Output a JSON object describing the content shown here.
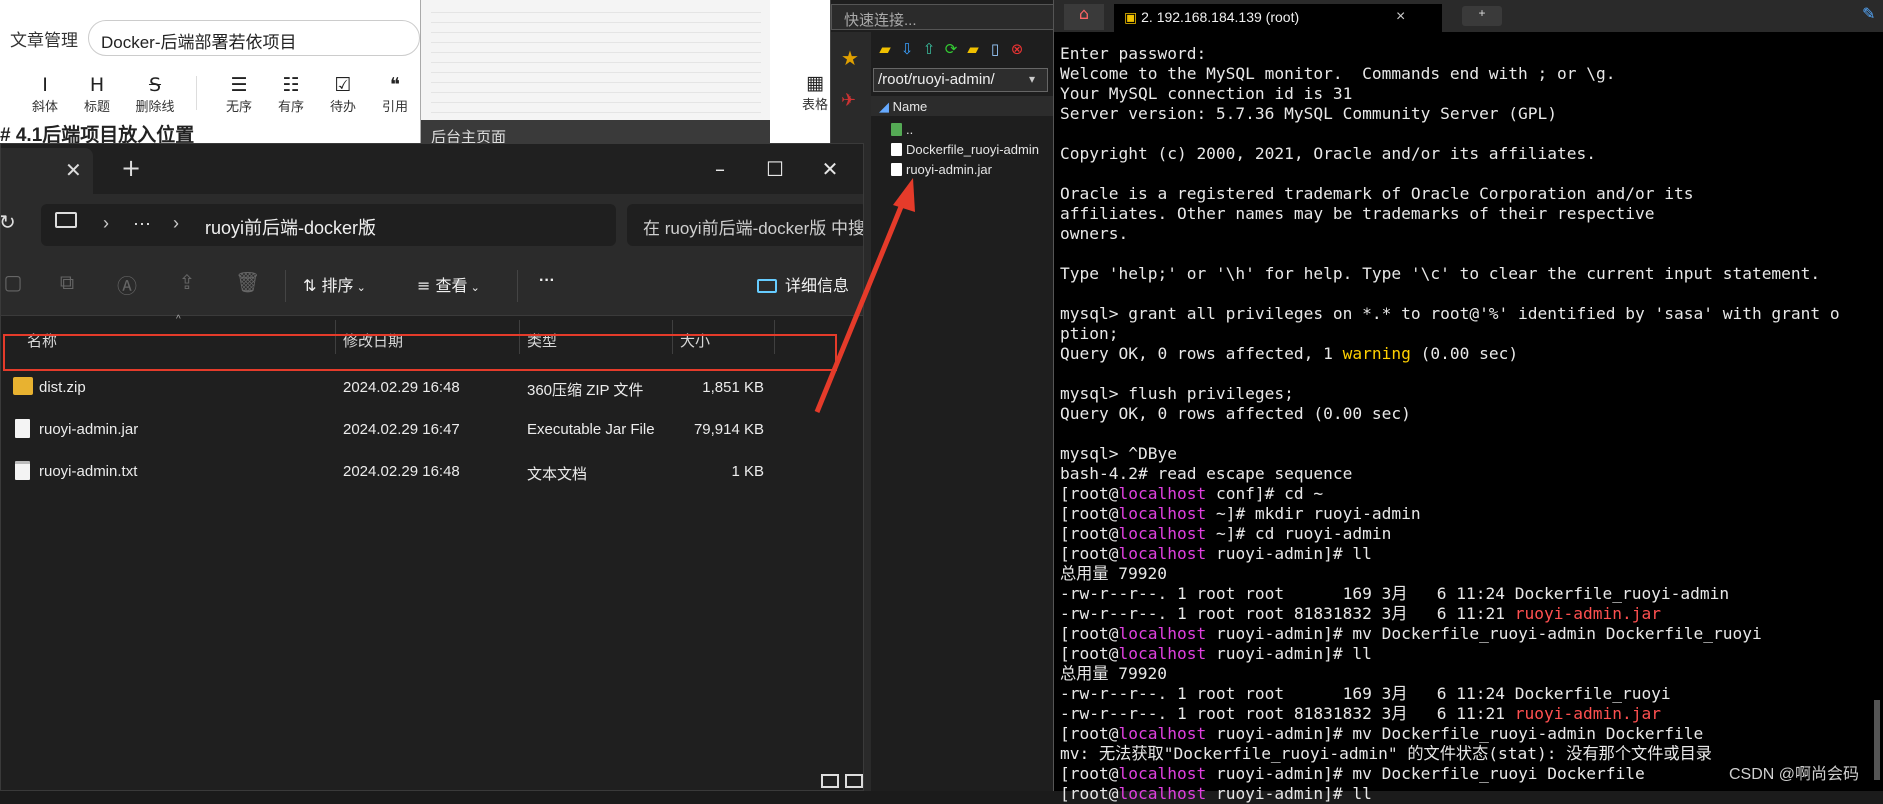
{
  "editor": {
    "crumb": "文章管理",
    "title": "Docker-后端部署若依项目",
    "toolbar": [
      {
        "icon": "I",
        "label": "斜体"
      },
      {
        "icon": "H",
        "label": "标题"
      },
      {
        "icon": "S",
        "label": "删除线"
      },
      {
        "icon": "☰",
        "label": "无序"
      },
      {
        "icon": "☷",
        "label": "有序"
      },
      {
        "icon": "☑",
        "label": "待办"
      },
      {
        "icon": "❝",
        "label": "引用"
      }
    ],
    "right_tool": {
      "icon": "▦",
      "label": "表格"
    },
    "heading": "# 4.1后端项目放入位置"
  },
  "thumb": {
    "bar_text": "后台主页面"
  },
  "explorer": {
    "address": {
      "more": "···",
      "folder": "ruoyi前后端-docker版"
    },
    "search_placeholder": "在 ruoyi前后端-docker版 中搜索",
    "commands": {
      "sort": "排序",
      "view": "查看",
      "more": "···",
      "details": "详细信息"
    },
    "columns": {
      "name": "名称",
      "date": "修改日期",
      "type": "类型",
      "size": "大小"
    },
    "files": [
      {
        "name": "dist.zip",
        "date": "2024.02.29 16:48",
        "type": "360压缩 ZIP 文件",
        "size": "1,851 KB",
        "icon": "zip-icon"
      },
      {
        "name": "ruoyi-admin.jar",
        "date": "2024.02.29 16:47",
        "type": "Executable Jar File",
        "size": "79,914 KB",
        "icon": "jar-file-icon"
      },
      {
        "name": "ruoyi-admin.txt",
        "date": "2024.02.29 16:48",
        "type": "文本文档",
        "size": "1 KB",
        "icon": "text-file-icon"
      }
    ]
  },
  "sftp": {
    "quick_connect": "快速连接...",
    "path": "/root/ruoyi-admin/",
    "column_name": "Name",
    "items": [
      {
        "name": ".."
      },
      {
        "name": "Dockerfile_ruoyi-admin"
      },
      {
        "name": "ruoyi-admin.jar"
      }
    ]
  },
  "terminal": {
    "session_tab": "2. 192.168.184.139 (root)",
    "close": "×",
    "watermark": "CSDN @啊尚会码",
    "lines": [
      "Enter password:",
      "Welcome to the MySQL monitor.  Commands end with ; or \\g.",
      "Your MySQL connection id is 31",
      "Server version: 5.7.36 MySQL Community Server (GPL)",
      "",
      "Copyright (c) 2000, 2021, Oracle and/or its affiliates.",
      "",
      "Oracle is a registered trademark of Oracle Corporation and/or its",
      "affiliates. Other names may be trademarks of their respective",
      "owners.",
      "",
      "Type 'help;' or '\\h' for help. Type '\\c' to clear the current input statement.",
      "",
      "mysql> grant all privileges on *.* to root@'%' identified by 'sasa' with grant o",
      "ption;",
      "Query OK, 0 rows affected, 1 {{w:warning}} (0.00 sec)",
      "",
      "mysql> flush privileges;",
      "Query OK, 0 rows affected (0.00 sec)",
      "",
      "mysql> ^DBye",
      "bash-4.2# read escape sequence",
      "[root@{{h:localhost}} conf]# cd ~",
      "[root@{{h:localhost}} ~]# mkdir ruoyi-admin",
      "[root@{{h:localhost}} ~]# cd ruoyi-admin",
      "[root@{{h:localhost}} ruoyi-admin]# ll",
      "总用量 79920",
      "-rw-r--r--. 1 root root      169 3月   6 11:24 Dockerfile_ruoyi-admin",
      "-rw-r--r--. 1 root root 81831832 3月   6 11:21 {{r:ruoyi-admin.jar}}",
      "[root@{{h:localhost}} ruoyi-admin]# mv Dockerfile_ruoyi-admin Dockerfile_ruoyi",
      "[root@{{h:localhost}} ruoyi-admin]# ll",
      "总用量 79920",
      "-rw-r--r--. 1 root root      169 3月   6 11:24 Dockerfile_ruoyi",
      "-rw-r--r--. 1 root root 81831832 3月   6 11:21 {{r:ruoyi-admin.jar}}",
      "[root@{{h:localhost}} ruoyi-admin]# mv Dockerfile_ruoyi-admin Dockerfile",
      "mv: 无法获取\"Dockerfile_ruoyi-admin\" 的文件状态(stat): 没有那个文件或目录",
      "[root@{{h:localhost}} ruoyi-admin]# mv Dockerfile_ruoyi Dockerfile",
      "[root@{{h:localhost}} ruoyi-admin]# ll"
    ]
  },
  "colors": {
    "highlight": "#e53b2a",
    "arrow": "#e53b2a",
    "warning": "#ffd000",
    "hostname": "#e040e0",
    "jar": "#ff5050"
  }
}
